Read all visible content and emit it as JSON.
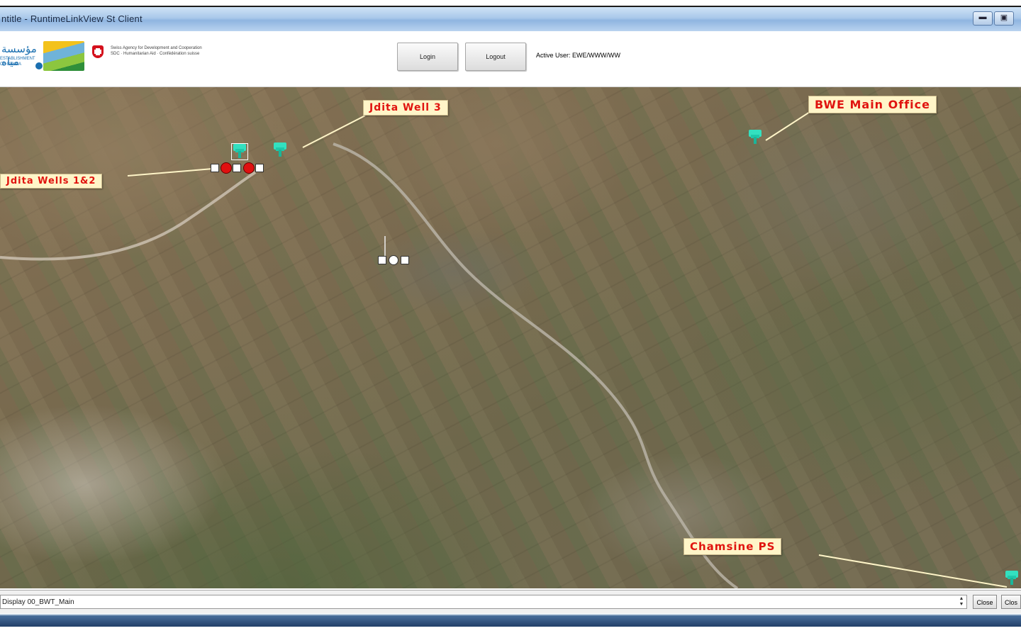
{
  "window": {
    "title": "ntitle - RuntimeLinkView St Client",
    "minimize_glyph": "▬",
    "maximize_glyph": "▣"
  },
  "toolbar": {
    "logo_arabic": "مؤسسة مياه",
    "logo_en_line1": "ESTABLISHMENT",
    "logo_en_line2": "OF BEKAA",
    "partner_text": "Swiss Agency for Development and Cooperation SDC · Humanitarian Aid · Confédération suisse",
    "login_label": "Login",
    "logout_label": "Logout",
    "status_prefix": "Active User:",
    "status_value": "EWE/WWW/WW"
  },
  "map": {
    "labels": {
      "jdita_well_3": "Jdita Well 3",
      "bwe_main_office": "BWE Main Office",
      "jdita_wells_12": "Jdita Wells 1&2",
      "chamsine_ps": "Chamsine PS"
    },
    "colors": {
      "label_text": "#e0140f",
      "label_bg": "#fff5c8",
      "pin": "#33e0c0",
      "well_marker": "#e01010"
    }
  },
  "bottom": {
    "display_name": "Display 00_BWT_Main",
    "close_label": "Close",
    "close2_label": "Clos",
    "spin_up": "▲",
    "spin_down": "▼"
  }
}
